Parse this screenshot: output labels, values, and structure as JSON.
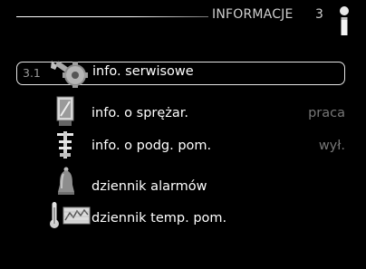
{
  "header": {
    "title": "INFORMACJE",
    "number": "3"
  },
  "menu": [
    {
      "id": "3.1",
      "label": "info. serwisowe",
      "status": "",
      "selected": true,
      "icon": "wrench-gear-icon"
    },
    {
      "id": "",
      "label": "info. o sprężar.",
      "status": "praca",
      "selected": false,
      "icon": "compressor-icon"
    },
    {
      "id": "",
      "label": "info. o podg. pom.",
      "status": "wył.",
      "selected": false,
      "icon": "heater-icon"
    },
    {
      "id": "",
      "label": "dziennik alarmów",
      "status": "",
      "selected": false,
      "icon": "bell-icon"
    },
    {
      "id": "",
      "label": "dziennik temp. pom.",
      "status": "",
      "selected": false,
      "icon": "temperature-log-icon"
    }
  ],
  "colors": {
    "background": "#000000",
    "text": "#ffffff",
    "status_text": "#777777",
    "selection_border": "#e6e6e6"
  }
}
